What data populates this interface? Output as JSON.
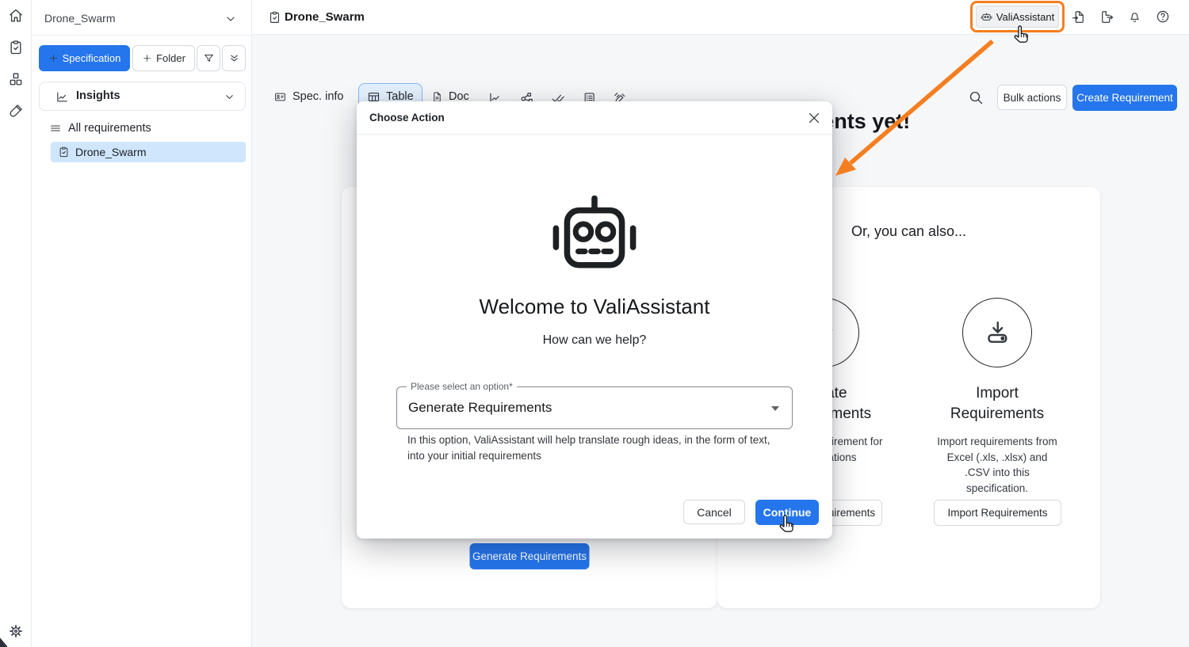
{
  "colors": {
    "accent_blue": "#2575ec",
    "annotation_orange": "#f57e20",
    "selected_item_bg": "#cfe6fd",
    "selected_tab_bg": "#e4f0fe",
    "content_bg": "#f6f7f9"
  },
  "iconbar": {
    "icons": [
      "home",
      "specifications",
      "components",
      "test-bench"
    ],
    "bottom_icon": "settings"
  },
  "sidebar": {
    "project_name": "Drone_Swarm",
    "specification_button": "Specification",
    "folder_button": "Folder",
    "insights_label": "Insights",
    "tree_header": "All requirements",
    "tree_items": [
      {
        "label": "Drone_Swarm",
        "selected": true
      }
    ]
  },
  "topbar": {
    "title": "Drone_Swarm",
    "vali_assistant_button": "ValiAssistant",
    "icons": [
      "import",
      "export",
      "notifications",
      "help"
    ]
  },
  "toolbar": {
    "tabs": [
      {
        "label": "Spec. info",
        "selected": false
      },
      {
        "label": "Table",
        "selected": true
      },
      {
        "label": "Doc",
        "selected": false
      }
    ],
    "icon_buttons": [
      "analytics",
      "hierarchy",
      "verification",
      "checklist",
      "ai-edit"
    ],
    "bulk_actions_button": "Bulk actions",
    "create_requirement_button": "Create Requirement"
  },
  "content": {
    "empty_heading": "You don't have any requirements yet!",
    "left_card": {
      "generate_button": "Generate Requirements"
    },
    "right_card": {
      "title": "Or, you can also...",
      "options": [
        {
          "icon": "pencil",
          "title": "Create Requirements",
          "description": "Create a requirement for\nspecifications",
          "button": "Create Requirements"
        },
        {
          "icon": "import",
          "title": "Import Requirements",
          "description": "Import requirements from\nExcel (.xls, .xlsx) and\n.CSV into this\nspecification.",
          "button": "Import Requirements"
        }
      ]
    }
  },
  "modal": {
    "title": "Choose Action",
    "welcome_heading": "Welcome to ValiAssistant",
    "welcome_subtitle": "How can we help?",
    "select_label": "Please select an option*",
    "select_value": "Generate Requirements",
    "helper_text": "In this option, ValiAssistant will help translate rough ideas, in the form of text,\ninto your initial requirements",
    "cancel_button": "Cancel",
    "continue_button": "Continue"
  }
}
